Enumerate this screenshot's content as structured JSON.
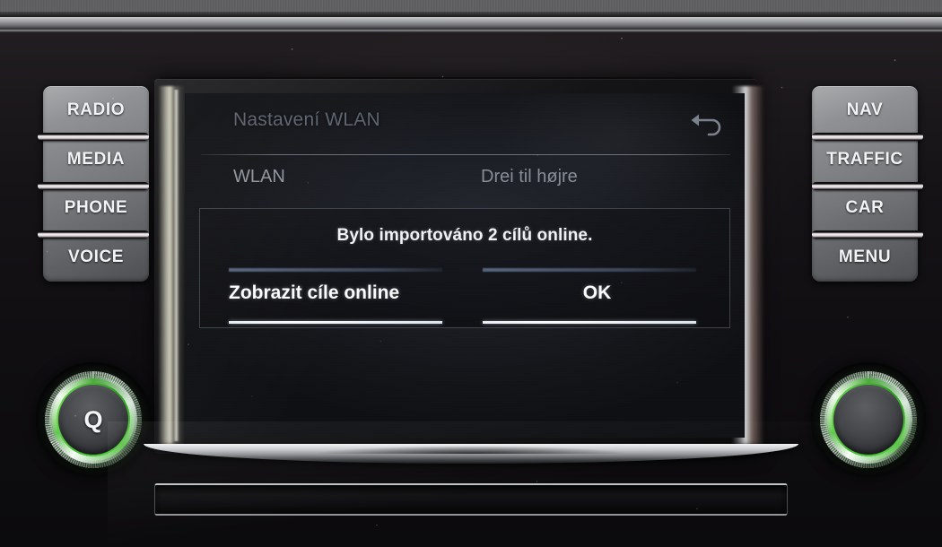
{
  "device": {
    "name": "car-infotainment-head-unit",
    "brand_accent_color": "#3fbf2e"
  },
  "screen": {
    "header": {
      "title": "Nastavení WLAN",
      "back_icon": "back-arrow-icon"
    },
    "row": {
      "left_label": "WLAN",
      "right_label": "Drei til højre"
    },
    "dialog": {
      "message": "Bylo importováno 2 cílů online.",
      "buttons": [
        {
          "label": "Zobrazit cíle online"
        },
        {
          "label": "OK"
        }
      ]
    }
  },
  "left_buttons": [
    {
      "label": "RADIO"
    },
    {
      "label": "MEDIA"
    },
    {
      "label": "PHONE"
    },
    {
      "label": "VOICE"
    }
  ],
  "right_buttons": [
    {
      "label": "NAV"
    },
    {
      "label": "TRAFFIC"
    },
    {
      "label": "CAR"
    },
    {
      "label": "MENU"
    }
  ],
  "knobs": {
    "left": {
      "glyph": "Q",
      "icon": "power-volume-knob"
    },
    "right": {
      "glyph": "",
      "icon": "tune-scroll-knob"
    }
  }
}
